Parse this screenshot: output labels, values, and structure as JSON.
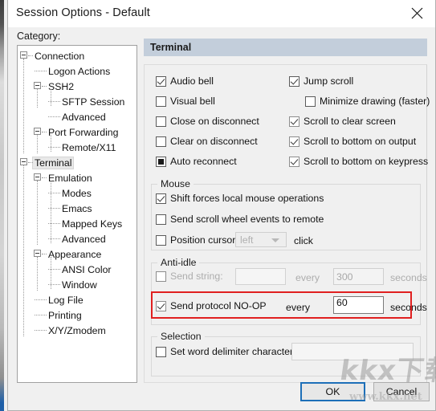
{
  "window": {
    "title": "Session Options - Default",
    "close_icon": "close-icon"
  },
  "category": {
    "label": "Category:",
    "tree": [
      {
        "label": "Connection",
        "depth": 0,
        "expander": true,
        "selected": false
      },
      {
        "label": "Logon Actions",
        "depth": 1,
        "expander": false,
        "selected": false
      },
      {
        "label": "SSH2",
        "depth": 1,
        "expander": true,
        "selected": false
      },
      {
        "label": "SFTP Session",
        "depth": 2,
        "expander": false,
        "selected": false
      },
      {
        "label": "Advanced",
        "depth": 2,
        "expander": false,
        "selected": false
      },
      {
        "label": "Port Forwarding",
        "depth": 1,
        "expander": true,
        "selected": false
      },
      {
        "label": "Remote/X11",
        "depth": 2,
        "expander": false,
        "selected": false
      },
      {
        "label": "Terminal",
        "depth": 0,
        "expander": true,
        "selected": true
      },
      {
        "label": "Emulation",
        "depth": 1,
        "expander": true,
        "selected": false
      },
      {
        "label": "Modes",
        "depth": 2,
        "expander": false,
        "selected": false
      },
      {
        "label": "Emacs",
        "depth": 2,
        "expander": false,
        "selected": false
      },
      {
        "label": "Mapped Keys",
        "depth": 2,
        "expander": false,
        "selected": false
      },
      {
        "label": "Advanced",
        "depth": 2,
        "expander": false,
        "selected": false
      },
      {
        "label": "Appearance",
        "depth": 1,
        "expander": true,
        "selected": false
      },
      {
        "label": "ANSI Color",
        "depth": 2,
        "expander": false,
        "selected": false
      },
      {
        "label": "Window",
        "depth": 2,
        "expander": false,
        "selected": false
      },
      {
        "label": "Log File",
        "depth": 1,
        "expander": false,
        "selected": false
      },
      {
        "label": "Printing",
        "depth": 1,
        "expander": false,
        "selected": false
      },
      {
        "label": "X/Y/Zmodem",
        "depth": 1,
        "expander": false,
        "selected": false
      }
    ]
  },
  "pane": {
    "header": "Terminal",
    "checkboxes": {
      "audio_bell": "Audio bell",
      "visual_bell": "Visual bell",
      "close_on_disconnect": "Close on disconnect",
      "clear_on_disconnect": "Clear on disconnect",
      "auto_reconnect": "Auto reconnect",
      "jump_scroll": "Jump scroll",
      "minimize_drawing": "Minimize drawing (faster)",
      "scroll_to_clear_screen": "Scroll to clear screen",
      "scroll_bottom_output": "Scroll to bottom on output",
      "scroll_bottom_keypress": "Scroll to bottom on keypress"
    },
    "mouse": {
      "title": "Mouse",
      "shift_forces": "Shift forces local mouse operations",
      "send_scroll_wheel": "Send scroll wheel events to remote",
      "position_cursor": "Position cursor on",
      "click_suffix": "click",
      "button_select_value": "left"
    },
    "anti_idle": {
      "title": "Anti-idle",
      "send_string_label": "Send string:",
      "send_string_value": "",
      "send_string_every": "every",
      "send_string_interval": "300",
      "send_string_seconds": "seconds",
      "noop_label": "Send protocol NO-OP",
      "noop_every": "every",
      "noop_interval": "60",
      "noop_seconds": "seconds"
    },
    "selection": {
      "title": "Selection",
      "set_word_delimiter": "Set word delimiter characters:",
      "delimiter_value": ""
    }
  },
  "footer": {
    "ok": "OK",
    "cancel": "Cancel"
  },
  "watermark": {
    "cn": "kkx下载",
    "url": "www.kkx.net"
  },
  "colors": {
    "pane_header": "#c3cedb",
    "accent": "#1d6fb8",
    "highlight": "#e02020"
  }
}
